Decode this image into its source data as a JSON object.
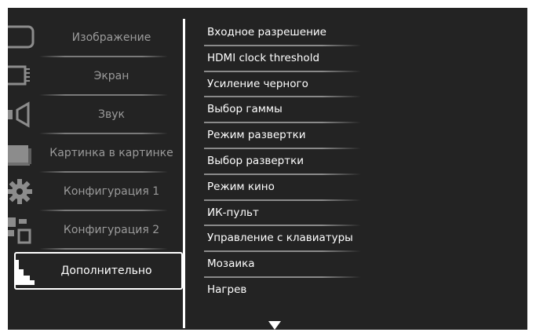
{
  "left_menu": {
    "items": [
      {
        "label": "Изображение",
        "icon": "picture-icon"
      },
      {
        "label": "Экран",
        "icon": "screen-icon"
      },
      {
        "label": "Звук",
        "icon": "speaker-icon"
      },
      {
        "label": "Картинка в картинке",
        "icon": "pip-icon"
      },
      {
        "label": "Конфигурация 1",
        "icon": "gear-icon"
      },
      {
        "label": "Конфигурация 2",
        "icon": "grid-icon"
      },
      {
        "label": "Дополнительно",
        "icon": "stairs-icon",
        "selected": true
      }
    ]
  },
  "sub_menu": {
    "items": [
      {
        "label": "Входное разрешение"
      },
      {
        "label": "HDMI clock threshold"
      },
      {
        "label": "Усиление черного"
      },
      {
        "label": "Выбор гаммы"
      },
      {
        "label": "Режим развертки"
      },
      {
        "label": "Выбор развертки"
      },
      {
        "label": "Режим кино"
      },
      {
        "label": "ИК-пульт"
      },
      {
        "label": "Управление с клавиатуры"
      },
      {
        "label": "Мозаика"
      },
      {
        "label": "Нагрев"
      }
    ]
  },
  "colors": {
    "background": "#232323",
    "text_active": "#ffffff",
    "text_inactive": "#9a9a9a"
  }
}
